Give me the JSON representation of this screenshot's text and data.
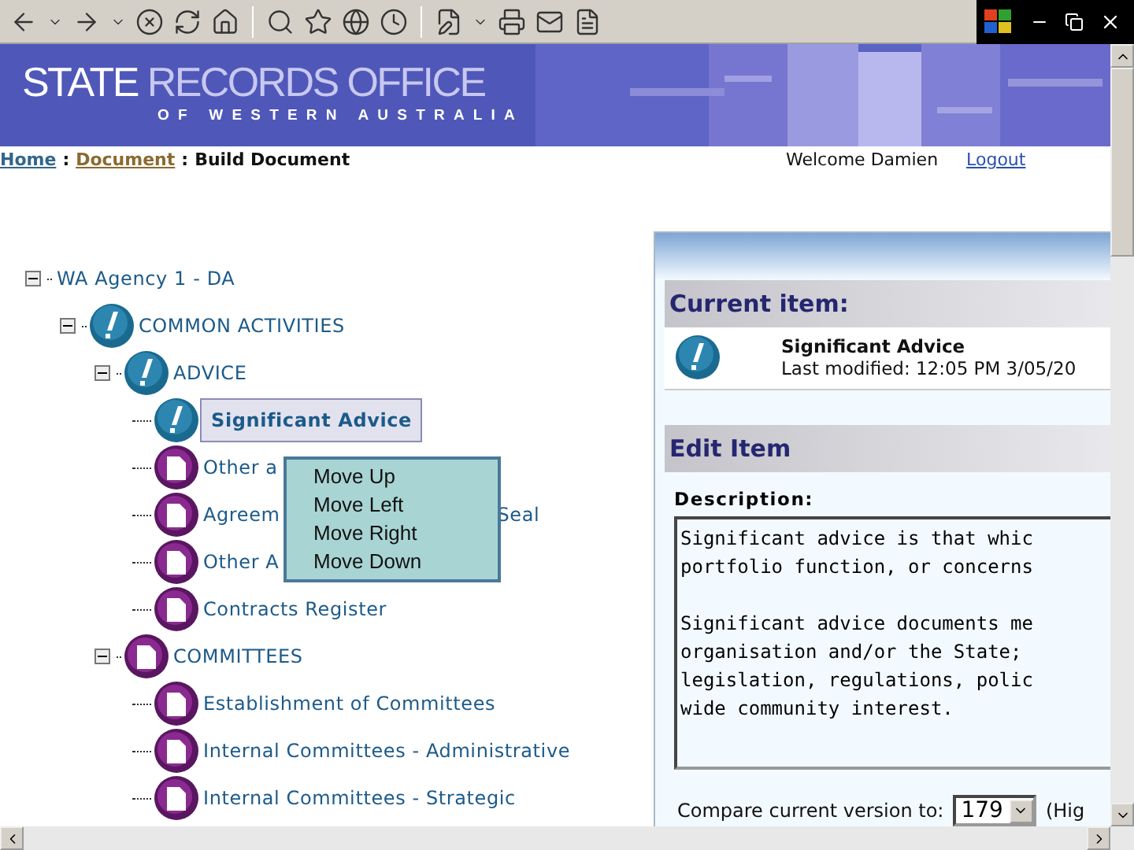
{
  "banner": {
    "title": [
      "STATE",
      "RECORDS OFFICE"
    ],
    "subtitle": "OF WESTERN AUSTRALIA"
  },
  "breadcrumb": [
    {
      "label": "Home",
      "kind": "link"
    },
    {
      "label": "Document",
      "kind": "visited"
    },
    {
      "label": "Build Document",
      "kind": "current"
    }
  ],
  "separator": ":",
  "welcome": "Welcome Damien",
  "logout": "Logout",
  "tree": [
    {
      "label": "WA Agency 1 - DA",
      "expanded": true,
      "selected": false,
      "children": [
        {
          "label": "COMMON ACTIVITIES",
          "kind": "info",
          "expanded": true,
          "selected": false,
          "children": [
            {
              "label": "ADVICE",
              "kind": "info",
              "expanded": true,
              "selected": false,
              "children": [
                {
                  "label": "Significant Advice",
                  "kind": "info",
                  "selected": true
                },
                {
                  "label": "Other a",
                  "kind": "document",
                  "selected": false
                },
                {
                  "label": "Agreem",
                  "label_end": "Seal",
                  "kind": "document",
                  "selected": false
                },
                {
                  "label": "Other A",
                  "kind": "document",
                  "selected": false
                },
                {
                  "label": "Contracts Register",
                  "kind": "document",
                  "selected": false
                }
              ]
            },
            {
              "label": "COMMITTEES",
              "kind": "document",
              "expanded": true,
              "selected": false,
              "children": [
                {
                  "label": "Establishment of Committees",
                  "kind": "document",
                  "selected": false
                },
                {
                  "label": "Internal Committees - Administrative",
                  "kind": "document",
                  "selected": false
                },
                {
                  "label": "Internal Committees - Strategic",
                  "kind": "document",
                  "selected": false
                }
              ]
            }
          ]
        }
      ]
    }
  ],
  "context_menu": [
    "Move Up",
    "Move Left",
    "Move Right",
    "Move Down"
  ],
  "current_item": {
    "heading": "Current item:",
    "name": "Significant Advice",
    "modified": "Last modified: 12:05 PM 3/05/20"
  },
  "edit_item": {
    "heading": "Edit Item",
    "description_label": "Description:",
    "description": "Significant advice is that whic\nportfolio function, or concerns\n\nSignificant advice documents me\norganisation and/or the State;\nlegislation, regulations, polic\nwide community interest.",
    "compare_label": "Compare current version to:",
    "compare_value": "179",
    "compare_note": "(Hig"
  }
}
